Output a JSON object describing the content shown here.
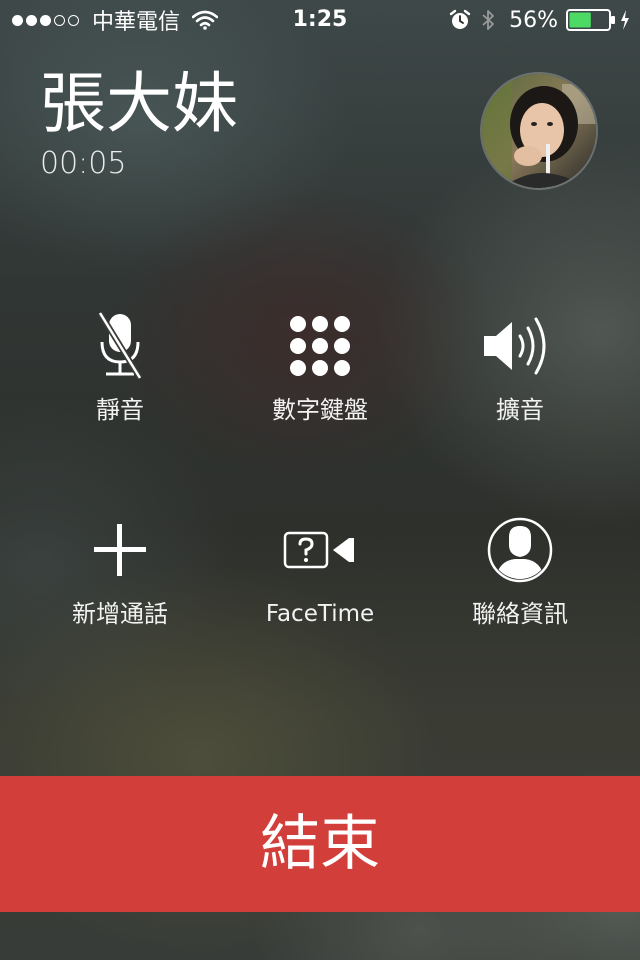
{
  "status_bar": {
    "signal_bars_filled": 3,
    "signal_bars_total": 5,
    "carrier": "中華電信",
    "time": "1:25",
    "battery_percent_label": "56%",
    "battery_level": 0.56,
    "wifi_icon": "wifi-icon",
    "alarm_icon": "alarm-clock-icon",
    "bluetooth_icon": "bluetooth-icon",
    "charging_icon": "charging-bolt-icon"
  },
  "call": {
    "caller_name": "張大妹",
    "duration": "00:05",
    "avatar_icon": "contact-photo"
  },
  "controls": {
    "mute": {
      "label": "靜音",
      "icon": "mute-microphone-icon"
    },
    "keypad": {
      "label": "數字鍵盤",
      "icon": "keypad-icon"
    },
    "speaker": {
      "label": "擴音",
      "icon": "speaker-icon"
    },
    "add_call": {
      "label": "新增通話",
      "icon": "plus-icon"
    },
    "facetime": {
      "label": "FaceTime",
      "icon": "facetime-icon"
    },
    "contacts": {
      "label": "聯絡資訊",
      "icon": "contact-person-icon"
    }
  },
  "end_call": {
    "label": "結束",
    "color": "#d23e3a"
  },
  "colors": {
    "battery_fill": "#4cd964",
    "text": "#ffffff"
  }
}
